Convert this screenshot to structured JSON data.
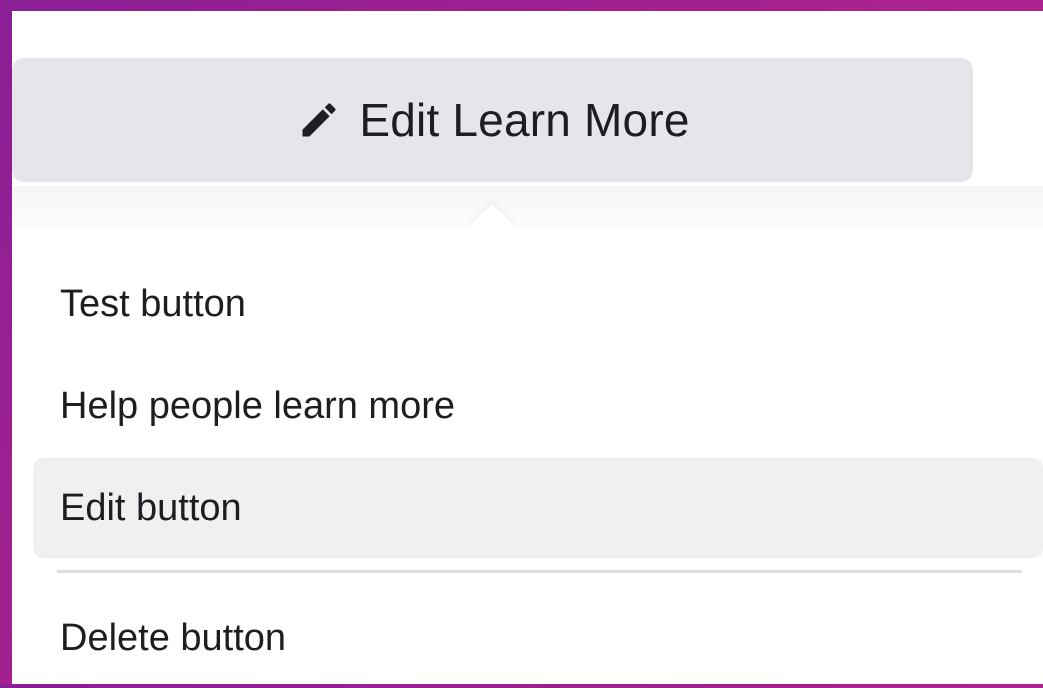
{
  "toolbar": {
    "edit_button_label": "Edit Learn More",
    "edit_button_icon": "pencil-icon"
  },
  "menu": {
    "items": [
      {
        "label": "Test button",
        "highlighted": false
      },
      {
        "label": "Help people learn more",
        "highlighted": false
      },
      {
        "label": "Edit button",
        "highlighted": true
      },
      {
        "label": "Delete button",
        "highlighted": false
      }
    ]
  },
  "colors": {
    "background_gradient_start": "#8a1f96",
    "background_gradient_end": "#c22a8a",
    "button_background": "#e4e6eb",
    "menu_highlight": "#f0f0f1",
    "text_primary": "#1c1e21",
    "divider": "#dadde1"
  }
}
